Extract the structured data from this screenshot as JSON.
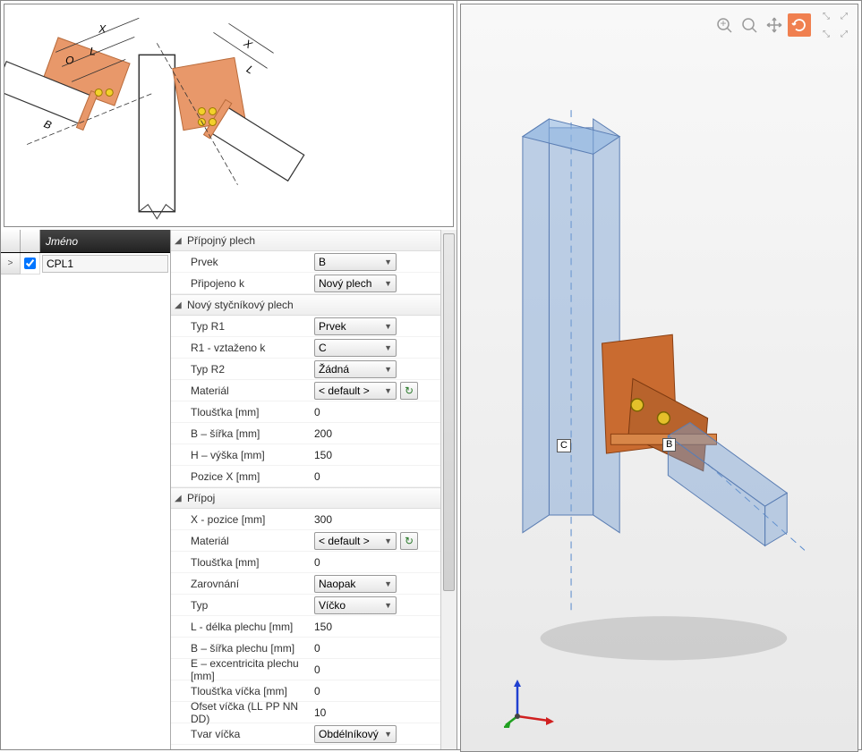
{
  "diagram_labels": {
    "X1": "X",
    "L1": "L",
    "O": "O",
    "B": "B",
    "X2": "X",
    "L2": "L"
  },
  "grid": {
    "header_name": "Jméno",
    "row_marker": ">",
    "row0_checked": true,
    "row0_name": "CPL1"
  },
  "sections": {
    "s1": {
      "title": "Přípojný plech",
      "prvek_label": "Prvek",
      "prvek_value": "B",
      "pripojeno_label": "Připojeno k",
      "pripojeno_value": "Nový plech"
    },
    "s2": {
      "title": "Nový styčníkový plech",
      "typr1_label": "Typ R1",
      "typr1_value": "Prvek",
      "r1vzt_label": "R1 - vztaženo k",
      "r1vzt_value": "C",
      "typr2_label": "Typ R2",
      "typr2_value": "Žádná",
      "mat_label": "Materiál",
      "mat_value": "< default >",
      "tl_label": "Tloušťka [mm]",
      "tl_value": "0",
      "bw_label": "B – šířka [mm]",
      "bw_value": "200",
      "hh_label": "H – výška [mm]",
      "hh_value": "150",
      "px_label": "Pozice X [mm]",
      "px_value": "0"
    },
    "s3": {
      "title": "Přípoj",
      "xp_label": "X - pozice [mm]",
      "xp_value": "300",
      "mat_label": "Materiál",
      "mat_value": "< default >",
      "tl_label": "Tloušťka [mm]",
      "tl_value": "0",
      "zar_label": "Zarovnání",
      "zar_value": "Naopak",
      "typ_label": "Typ",
      "typ_value": "Víčko",
      "ld_label": "L - délka plechu [mm]",
      "ld_value": "150",
      "bs_label": "B – šířka plechu [mm]",
      "bs_value": "0",
      "ee_label": "E – excentricita plechu [mm]",
      "ee_value": "0",
      "tv_label": "Tloušťka víčka [mm]",
      "tv_value": "0",
      "ov_label": "Ofset víčka (LL PP NN DD)",
      "ov_value": "10",
      "tvar_label": "Tvar víčka",
      "tvar_value": "Obdélníkový"
    }
  },
  "viewport": {
    "label_C": "C",
    "label_B": "B"
  }
}
